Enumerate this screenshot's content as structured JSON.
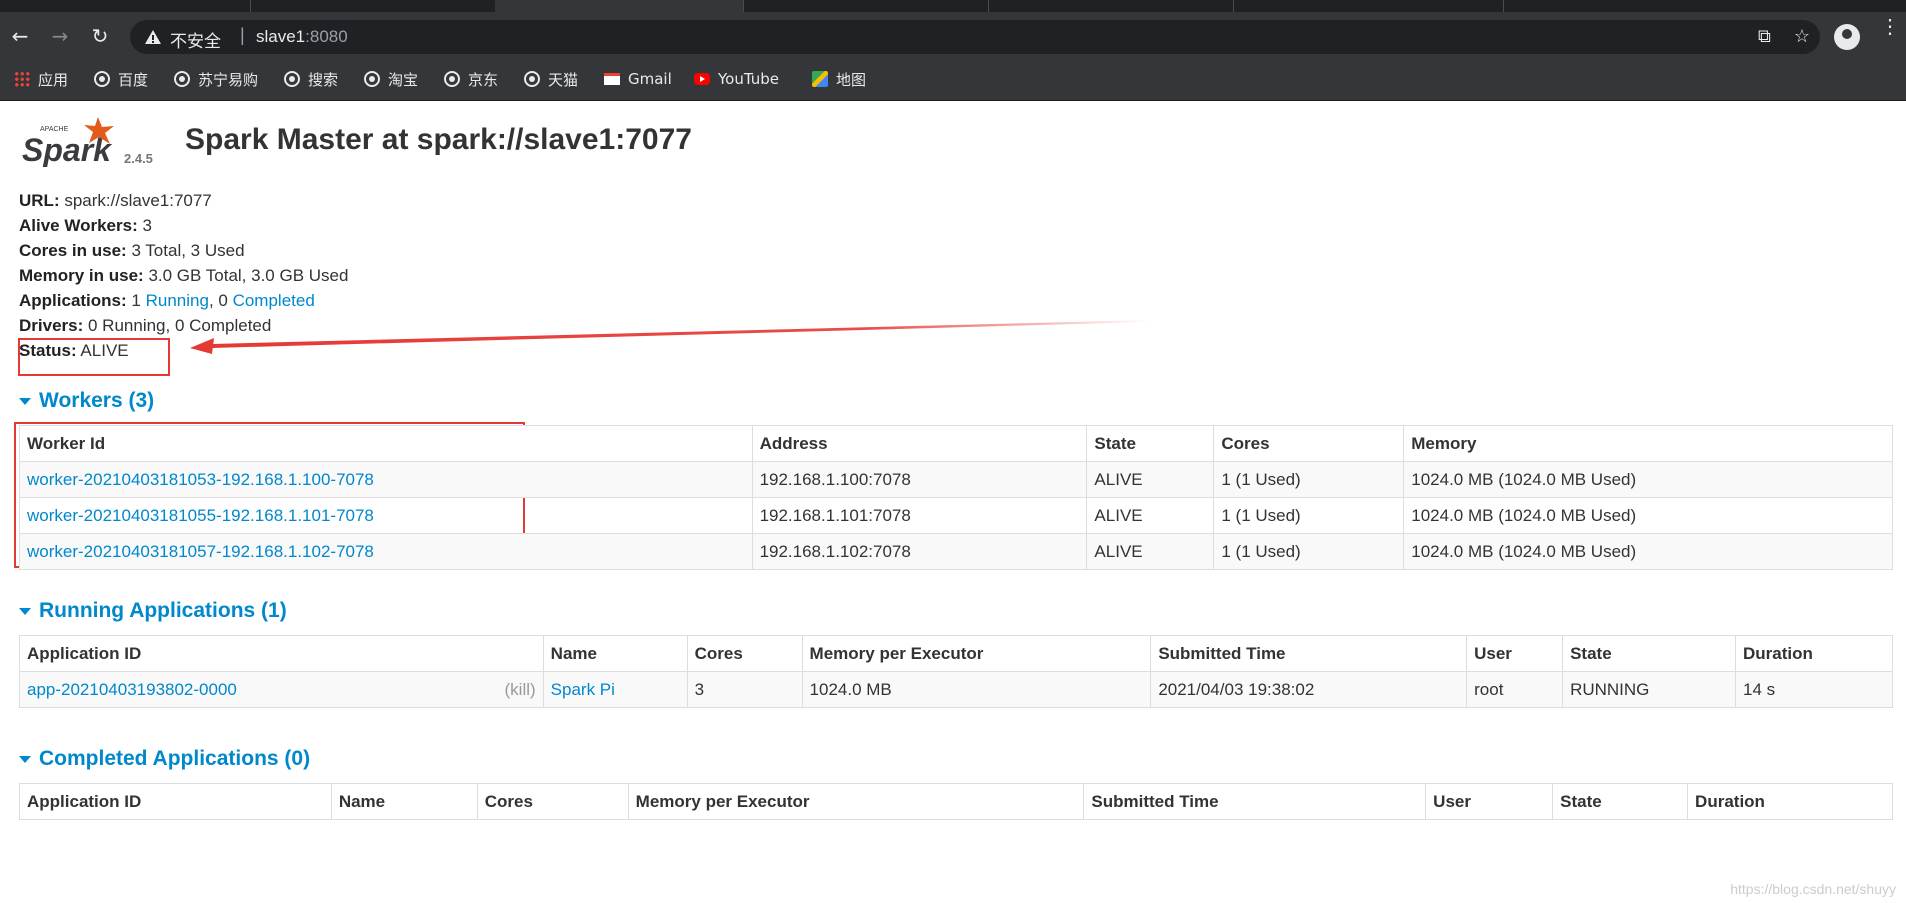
{
  "browser": {
    "insecure_label": "不安全",
    "separator": "|",
    "host": "slave1",
    "port": ":8080",
    "bookmarks": [
      "应用",
      "百度",
      "苏宁易购",
      "搜索",
      "淘宝",
      "京东",
      "天猫",
      "Gmail",
      "YouTube",
      "地图"
    ]
  },
  "spark": {
    "logo_text": "Spark",
    "logo_small": "APACHE",
    "version": "2.4.5",
    "title": "Spark Master at spark://slave1:7077",
    "summary": {
      "url_label": "URL:",
      "url_value": "spark://slave1:7077",
      "alive_workers_label": "Alive Workers:",
      "alive_workers_value": "3",
      "cores_label": "Cores in use:",
      "cores_value": "3 Total, 3 Used",
      "memory_label": "Memory in use:",
      "memory_value": "3.0 GB Total, 3.0 GB Used",
      "applications_label": "Applications:",
      "applications_running_count": "1",
      "applications_running_link": "Running",
      "applications_sep": ", 0",
      "applications_completed_link": "Completed",
      "drivers_label": "Drivers:",
      "drivers_value": "0 Running, 0 Completed",
      "status_label": "Status:",
      "status_value": "ALIVE"
    },
    "workers": {
      "title": "Workers (3)",
      "columns": [
        "Worker Id",
        "Address",
        "State",
        "Cores",
        "Memory"
      ],
      "rows": [
        [
          "worker-20210403181053-192.168.1.100-7078",
          "192.168.1.100:7078",
          "ALIVE",
          "1 (1 Used)",
          "1024.0 MB (1024.0 MB Used)"
        ],
        [
          "worker-20210403181055-192.168.1.101-7078",
          "192.168.1.101:7078",
          "ALIVE",
          "1 (1 Used)",
          "1024.0 MB (1024.0 MB Used)"
        ],
        [
          "worker-20210403181057-192.168.1.102-7078",
          "192.168.1.102:7078",
          "ALIVE",
          "1 (1 Used)",
          "1024.0 MB (1024.0 MB Used)"
        ]
      ]
    },
    "running_apps": {
      "title": "Running Applications (1)",
      "columns": [
        "Application ID",
        "Name",
        "Cores",
        "Memory per Executor",
        "Submitted Time",
        "User",
        "State",
        "Duration"
      ],
      "rows": [
        [
          "app-20210403193802-0000",
          "Spark Pi",
          "3",
          "1024.0 MB",
          "2021/04/03 19:38:02",
          "root",
          "RUNNING",
          "14 s"
        ]
      ],
      "kill_label": "(kill)"
    },
    "completed_apps": {
      "title": "Completed Applications (0)",
      "columns": [
        "Application ID",
        "Name",
        "Cores",
        "Memory per Executor",
        "Submitted Time",
        "User",
        "State",
        "Duration"
      ]
    }
  },
  "watermark": "https://blog.csdn.net/shuyy"
}
